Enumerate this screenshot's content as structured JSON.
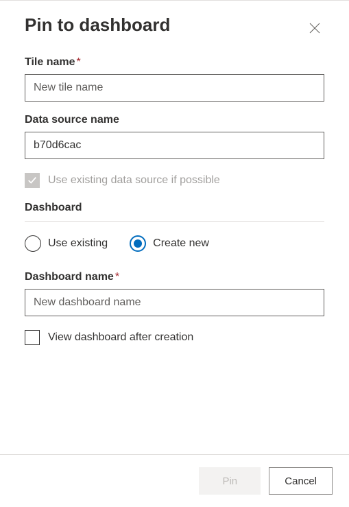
{
  "dialog": {
    "title": "Pin to dashboard"
  },
  "tile": {
    "label": "Tile name",
    "placeholder": "New tile name",
    "value": ""
  },
  "dataSource": {
    "label": "Data source name",
    "value": "b70d6cac"
  },
  "useExistingSource": {
    "label": "Use existing data source if possible"
  },
  "dashboardSection": {
    "label": "Dashboard"
  },
  "radio": {
    "useExisting": "Use existing",
    "createNew": "Create new"
  },
  "dashboardName": {
    "label": "Dashboard name",
    "placeholder": "New dashboard name",
    "value": ""
  },
  "viewAfter": {
    "label": "View dashboard after creation"
  },
  "buttons": {
    "pin": "Pin",
    "cancel": "Cancel"
  }
}
